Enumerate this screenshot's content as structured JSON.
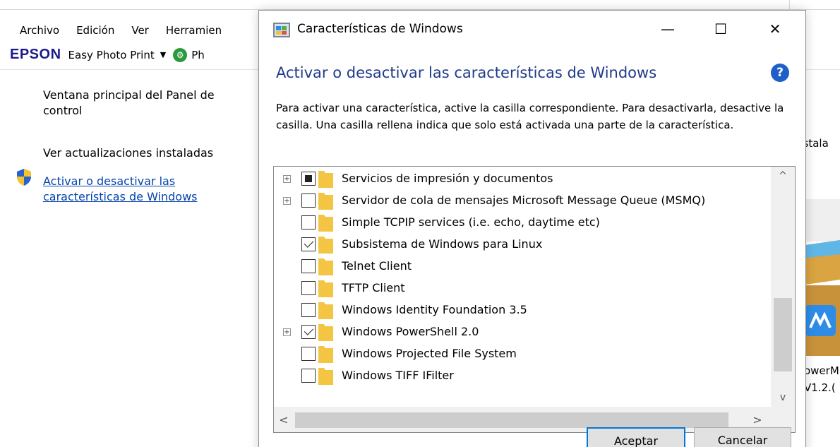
{
  "background": {
    "menu": [
      "Archivo",
      "Edición",
      "Ver",
      "Herramien"
    ],
    "epson": {
      "logo": "EPSON",
      "app": "Easy Photo Print",
      "dropdown": "▼",
      "next_label": "Ph"
    },
    "sidebar": {
      "main_panel": "Ventana principal del Panel de control",
      "updates": "Ver actualizaciones instaladas",
      "features_link": "Activar o desactivar las características de Windows"
    },
    "right_partial": {
      "install_text": "nstala",
      "program_line1": "owerM",
      "program_line2": "V1.2.("
    }
  },
  "dialog": {
    "title": "Características de Windows",
    "controls": {
      "minimize": "—",
      "maximize": "☐",
      "close": "✕"
    },
    "heading": "Activar o desactivar las características de Windows",
    "help": "?",
    "description": "Para activar una característica, active la casilla correspondiente. Para desactivarla, desactive la casilla. Una casilla rellena indica que solo está activada una parte de la característica.",
    "features": [
      {
        "label": "Servicios de impresión y documentos",
        "state": "partial",
        "expandable": true
      },
      {
        "label": "Servidor de cola de mensajes Microsoft Message Queue (MSMQ)",
        "state": "unchecked",
        "expandable": true
      },
      {
        "label": "Simple TCPIP services (i.e. echo, daytime etc)",
        "state": "unchecked",
        "expandable": false
      },
      {
        "label": "Subsistema de Windows para Linux",
        "state": "checked",
        "expandable": false
      },
      {
        "label": "Telnet Client",
        "state": "unchecked",
        "expandable": false
      },
      {
        "label": "TFTP Client",
        "state": "unchecked",
        "expandable": false
      },
      {
        "label": "Windows Identity Foundation 3.5",
        "state": "unchecked",
        "expandable": false
      },
      {
        "label": "Windows PowerShell 2.0",
        "state": "checked",
        "expandable": true
      },
      {
        "label": "Windows Projected File System",
        "state": "unchecked",
        "expandable": false
      },
      {
        "label": "Windows TIFF IFilter",
        "state": "unchecked",
        "expandable": false
      }
    ],
    "scroll": {
      "up": "^",
      "down": "v",
      "left": "<",
      "right": ">"
    },
    "buttons": {
      "ok": "Aceptar",
      "cancel": "Cancelar"
    },
    "colors": {
      "heading": "#1f3a8a",
      "link": "#0645ad",
      "accent": "#0078d7",
      "folder": "#f4c542"
    }
  }
}
